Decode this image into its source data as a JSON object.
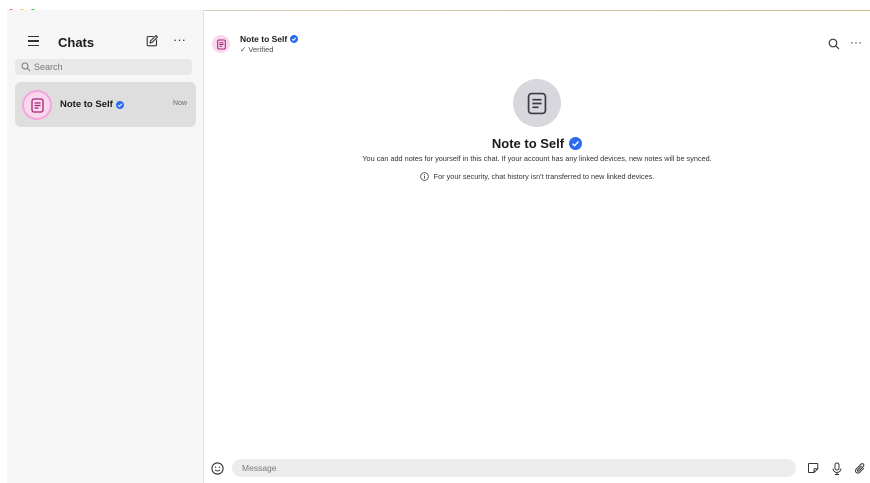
{
  "sidebar": {
    "title": "Chats",
    "search_placeholder": "Search",
    "chats": [
      {
        "name": "Note to Self",
        "time": "Now",
        "verified": true
      }
    ]
  },
  "conversation": {
    "name": "Note to Self",
    "status": "✓ Verified"
  },
  "intro": {
    "title": "Note to Self",
    "description": "You can add notes for yourself in this chat. If your account has any linked devices, new notes will be synced.",
    "security_note": "For your security, chat history isn't transferred to new linked devices."
  },
  "composer": {
    "placeholder": "Message"
  },
  "colors": {
    "accent": "#2c6bed",
    "avatar_pink": "#f8d7ef",
    "avatar_icon": "#a3266f",
    "selected_row": "#dedede"
  },
  "icons": {
    "menu": "hamburger-icon",
    "compose": "compose-icon",
    "more": "more-icon",
    "search": "search-icon",
    "note": "note-icon",
    "verified": "verified-badge-icon",
    "info": "info-icon",
    "emoji": "emoji-icon",
    "sticker": "sticker-icon",
    "mic": "mic-icon",
    "attach": "attachment-icon"
  }
}
